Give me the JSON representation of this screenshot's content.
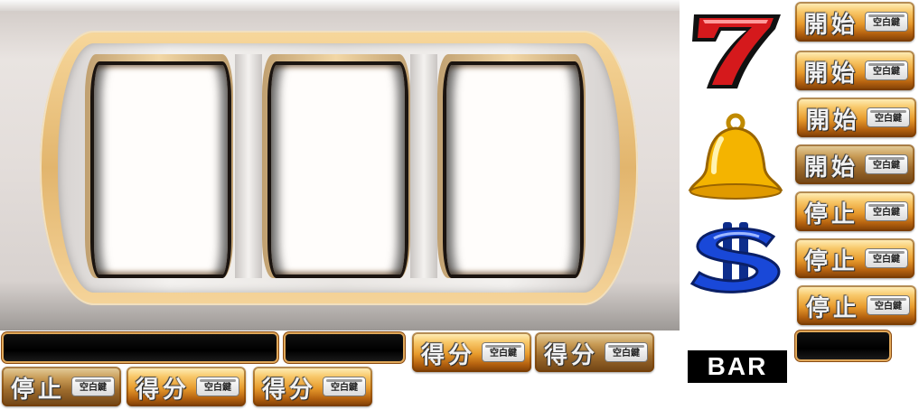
{
  "sprites": {
    "start_label": "開始",
    "stop_label": "停止",
    "score_label": "得分",
    "key_label": "空白鍵",
    "bar_text": "BAR"
  },
  "symbols": [
    "seven-icon",
    "bell-icon",
    "dollar-icon",
    "bar-symbol"
  ],
  "colors": {
    "button_orange": "#e79a2c",
    "gold_frame": "#e2b56d",
    "seven_red": "#d5191c",
    "bell_gold": "#f4b400",
    "dollar_blue": "#1948d8"
  }
}
